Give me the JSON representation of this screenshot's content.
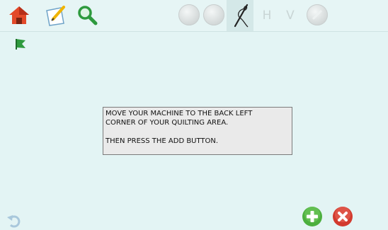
{
  "toolbar": {
    "icons": [
      "home-icon",
      "pattern-edit-icon",
      "zoom-icon"
    ],
    "disabled_buttons": [
      "circle-button-1",
      "circle-button-2"
    ],
    "needle_icon": "needle-thread-icon",
    "h_label": "H",
    "v_label": "V",
    "check_icon": "check-disabled-icon"
  },
  "marker": {
    "icon": "green-flag-icon"
  },
  "instruction": {
    "text": "MOVE YOUR MACHINE TO THE BACK LEFT\nCORNER OF YOUR QUILTING AREA.\n\nTHEN PRESS THE ADD BUTTON."
  },
  "footer": {
    "undo_icon": "undo-icon",
    "add_icon": "add-icon",
    "cancel_icon": "cancel-icon"
  },
  "colors": {
    "background": "#e3f4f4",
    "add_green": "#4caf3e",
    "cancel_red": "#d23a2e"
  }
}
